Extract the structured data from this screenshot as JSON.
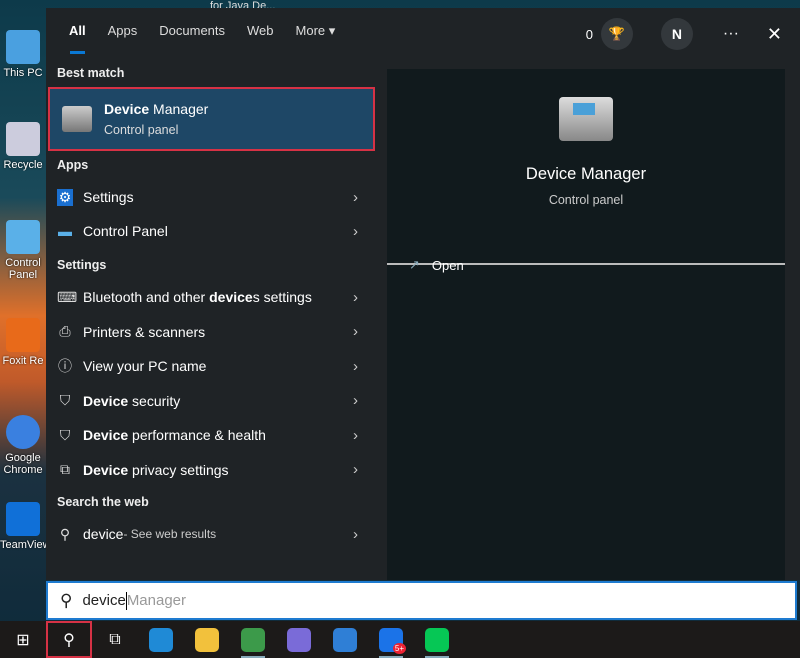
{
  "desktop": {
    "top_text": "for Java De...",
    "icons": [
      "This PC",
      "Recycle",
      "Control Panel",
      "Foxit Re",
      "Google Chrome",
      "TeamViewer"
    ]
  },
  "tabs": [
    {
      "label": "All",
      "active": true
    },
    {
      "label": "Apps"
    },
    {
      "label": "Documents"
    },
    {
      "label": "Web"
    },
    {
      "label": "More ▾"
    }
  ],
  "header": {
    "points": "0",
    "avatar": "N",
    "more": "···",
    "close": "✕"
  },
  "best_match": {
    "section": "Best match",
    "bold": "Device",
    "rest": " Manager",
    "subtitle": "Control panel"
  },
  "apps": {
    "section": "Apps",
    "items": [
      {
        "label": "Settings",
        "icon": "gear-icon"
      },
      {
        "label": "Control Panel",
        "icon": "control-panel-icon"
      }
    ]
  },
  "settings": {
    "section": "Settings",
    "items": [
      {
        "pre": "Bluetooth and other ",
        "bold": "device",
        "post": "s settings",
        "icon": "bluetooth-devices-icon"
      },
      {
        "pre": "Printers & scanners",
        "bold": "",
        "post": "",
        "icon": "printer-icon"
      },
      {
        "pre": "View your PC name",
        "bold": "",
        "post": "",
        "icon": "info-icon"
      },
      {
        "pre": "",
        "bold": "Device",
        "post": " security",
        "icon": "shield-icon"
      },
      {
        "pre": "",
        "bold": "Device",
        "post": " performance & health",
        "icon": "shield-icon"
      },
      {
        "pre": "",
        "bold": "Device",
        "post": " privacy settings",
        "icon": "privacy-icon"
      }
    ]
  },
  "web": {
    "section": "Search the web",
    "query": "device",
    "suffix": " - See web results"
  },
  "preview": {
    "title": "Device Manager",
    "subtitle": "Control panel",
    "open_label": "Open"
  },
  "search": {
    "typed": "device",
    "suggestion": "Manager"
  },
  "taskbar": [
    {
      "name": "start"
    },
    {
      "name": "search"
    },
    {
      "name": "task-view"
    },
    {
      "name": "edge",
      "color": "#1f8ad6"
    },
    {
      "name": "file-explorer",
      "color": "#f2c13c"
    },
    {
      "name": "chrome",
      "color": "#3c9a4a"
    },
    {
      "name": "copilot",
      "color": "#7a6bd8"
    },
    {
      "name": "app",
      "color": "#2f7fd6"
    },
    {
      "name": "zalo",
      "color": "#1b73e8",
      "badge": "5+"
    },
    {
      "name": "line",
      "color": "#06c755"
    }
  ]
}
